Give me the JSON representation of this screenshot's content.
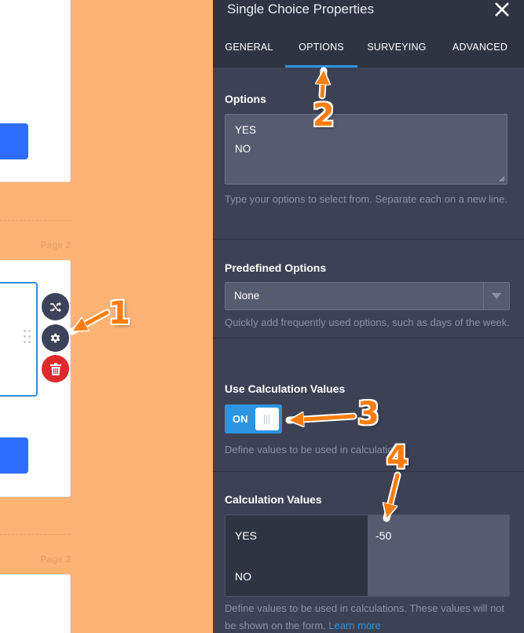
{
  "builder": {
    "page_labels": [
      "Page 2",
      "Page 3"
    ]
  },
  "panel": {
    "title": "Single Choice Properties",
    "tabs": [
      {
        "label": "GENERAL",
        "active": false
      },
      {
        "label": "OPTIONS",
        "active": true
      },
      {
        "label": "SURVEYING",
        "active": false
      },
      {
        "label": "ADVANCED",
        "active": false
      }
    ],
    "options": {
      "title": "Options",
      "lines": [
        "YES",
        "NO"
      ],
      "help": "Type your options to select from. Separate each on a new line."
    },
    "predefined": {
      "title": "Predefined Options",
      "selected": "None",
      "help": "Quickly add frequently used options, such as days of the week."
    },
    "use_calc": {
      "title": "Use Calculation Values",
      "toggle_label": "ON",
      "toggle_on": true,
      "help": "Define values to be used in calculations."
    },
    "calc_values": {
      "title": "Calculation Values",
      "rows": [
        {
          "option": "YES",
          "value": "-50"
        },
        {
          "option": "NO",
          "value": ""
        }
      ],
      "help": "Define values to be used in calculations. These values will not be shown on the form.",
      "link": "Learn more"
    }
  },
  "annotations": [
    "1",
    "2",
    "3",
    "4"
  ],
  "colors": {
    "background": "#fdb374",
    "panel": "#3c4254",
    "panel_header": "#2f3443",
    "accent": "#2d94e2",
    "annotation": "#ff7d0c",
    "delete": "#dd2a2a",
    "builder_button": "#2f6dfc"
  }
}
